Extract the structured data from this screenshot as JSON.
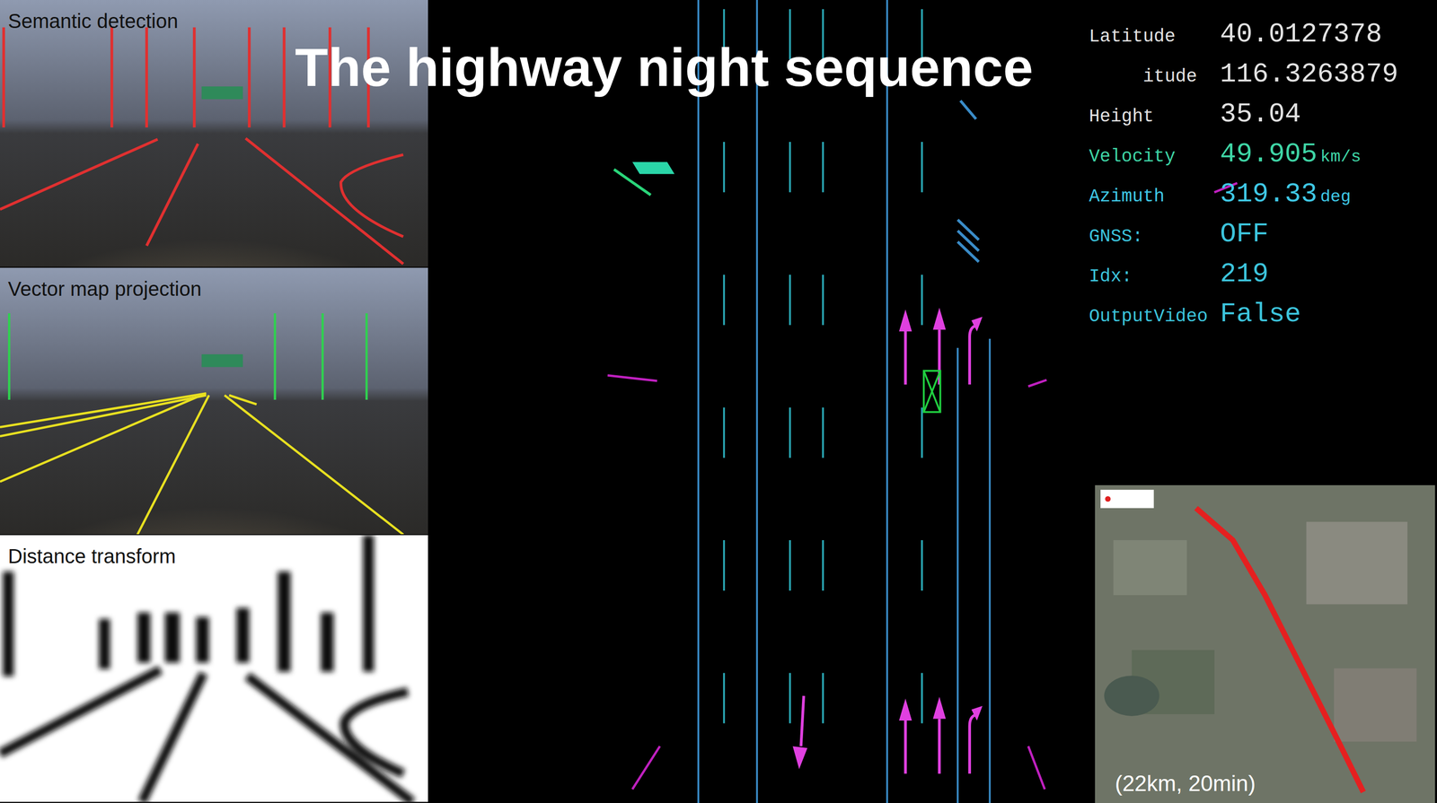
{
  "title": "The highway night sequence",
  "camera_panels": [
    {
      "label": "Semantic detection",
      "kind": "semantic"
    },
    {
      "label": "Vector map projection",
      "kind": "projection"
    },
    {
      "label": "Distance transform",
      "kind": "distance"
    }
  ],
  "telemetry": [
    {
      "label": "Latitude",
      "value": "40.0127378",
      "unit": "",
      "color": "#e2e2e2",
      "covered": false
    },
    {
      "label": "itude",
      "value": "116.3263879",
      "unit": "",
      "color": "#e2e2e2",
      "covered": true
    },
    {
      "label": "Height",
      "value": "35.04",
      "unit": "",
      "color": "#e2e2e2",
      "covered": false
    },
    {
      "label": "Velocity",
      "value": "49.905",
      "unit": "km/s",
      "color": "#3fd6a6",
      "covered": false
    },
    {
      "label": "Azimuth",
      "value": "319.33",
      "unit": "deg",
      "color": "#3fc8e6",
      "covered": false
    },
    {
      "label": "GNSS:",
      "value": "OFF",
      "unit": "",
      "color": "#3cc4dc",
      "covered": false
    },
    {
      "label": "Idx:",
      "value": "219",
      "unit": "",
      "color": "#3cc4dc",
      "covered": false
    },
    {
      "label": "OutputVideo",
      "value": "False",
      "unit": "",
      "color": "#3cc4dc",
      "covered": false
    }
  ],
  "map_inset": {
    "caption": "(22km, 20min)"
  }
}
